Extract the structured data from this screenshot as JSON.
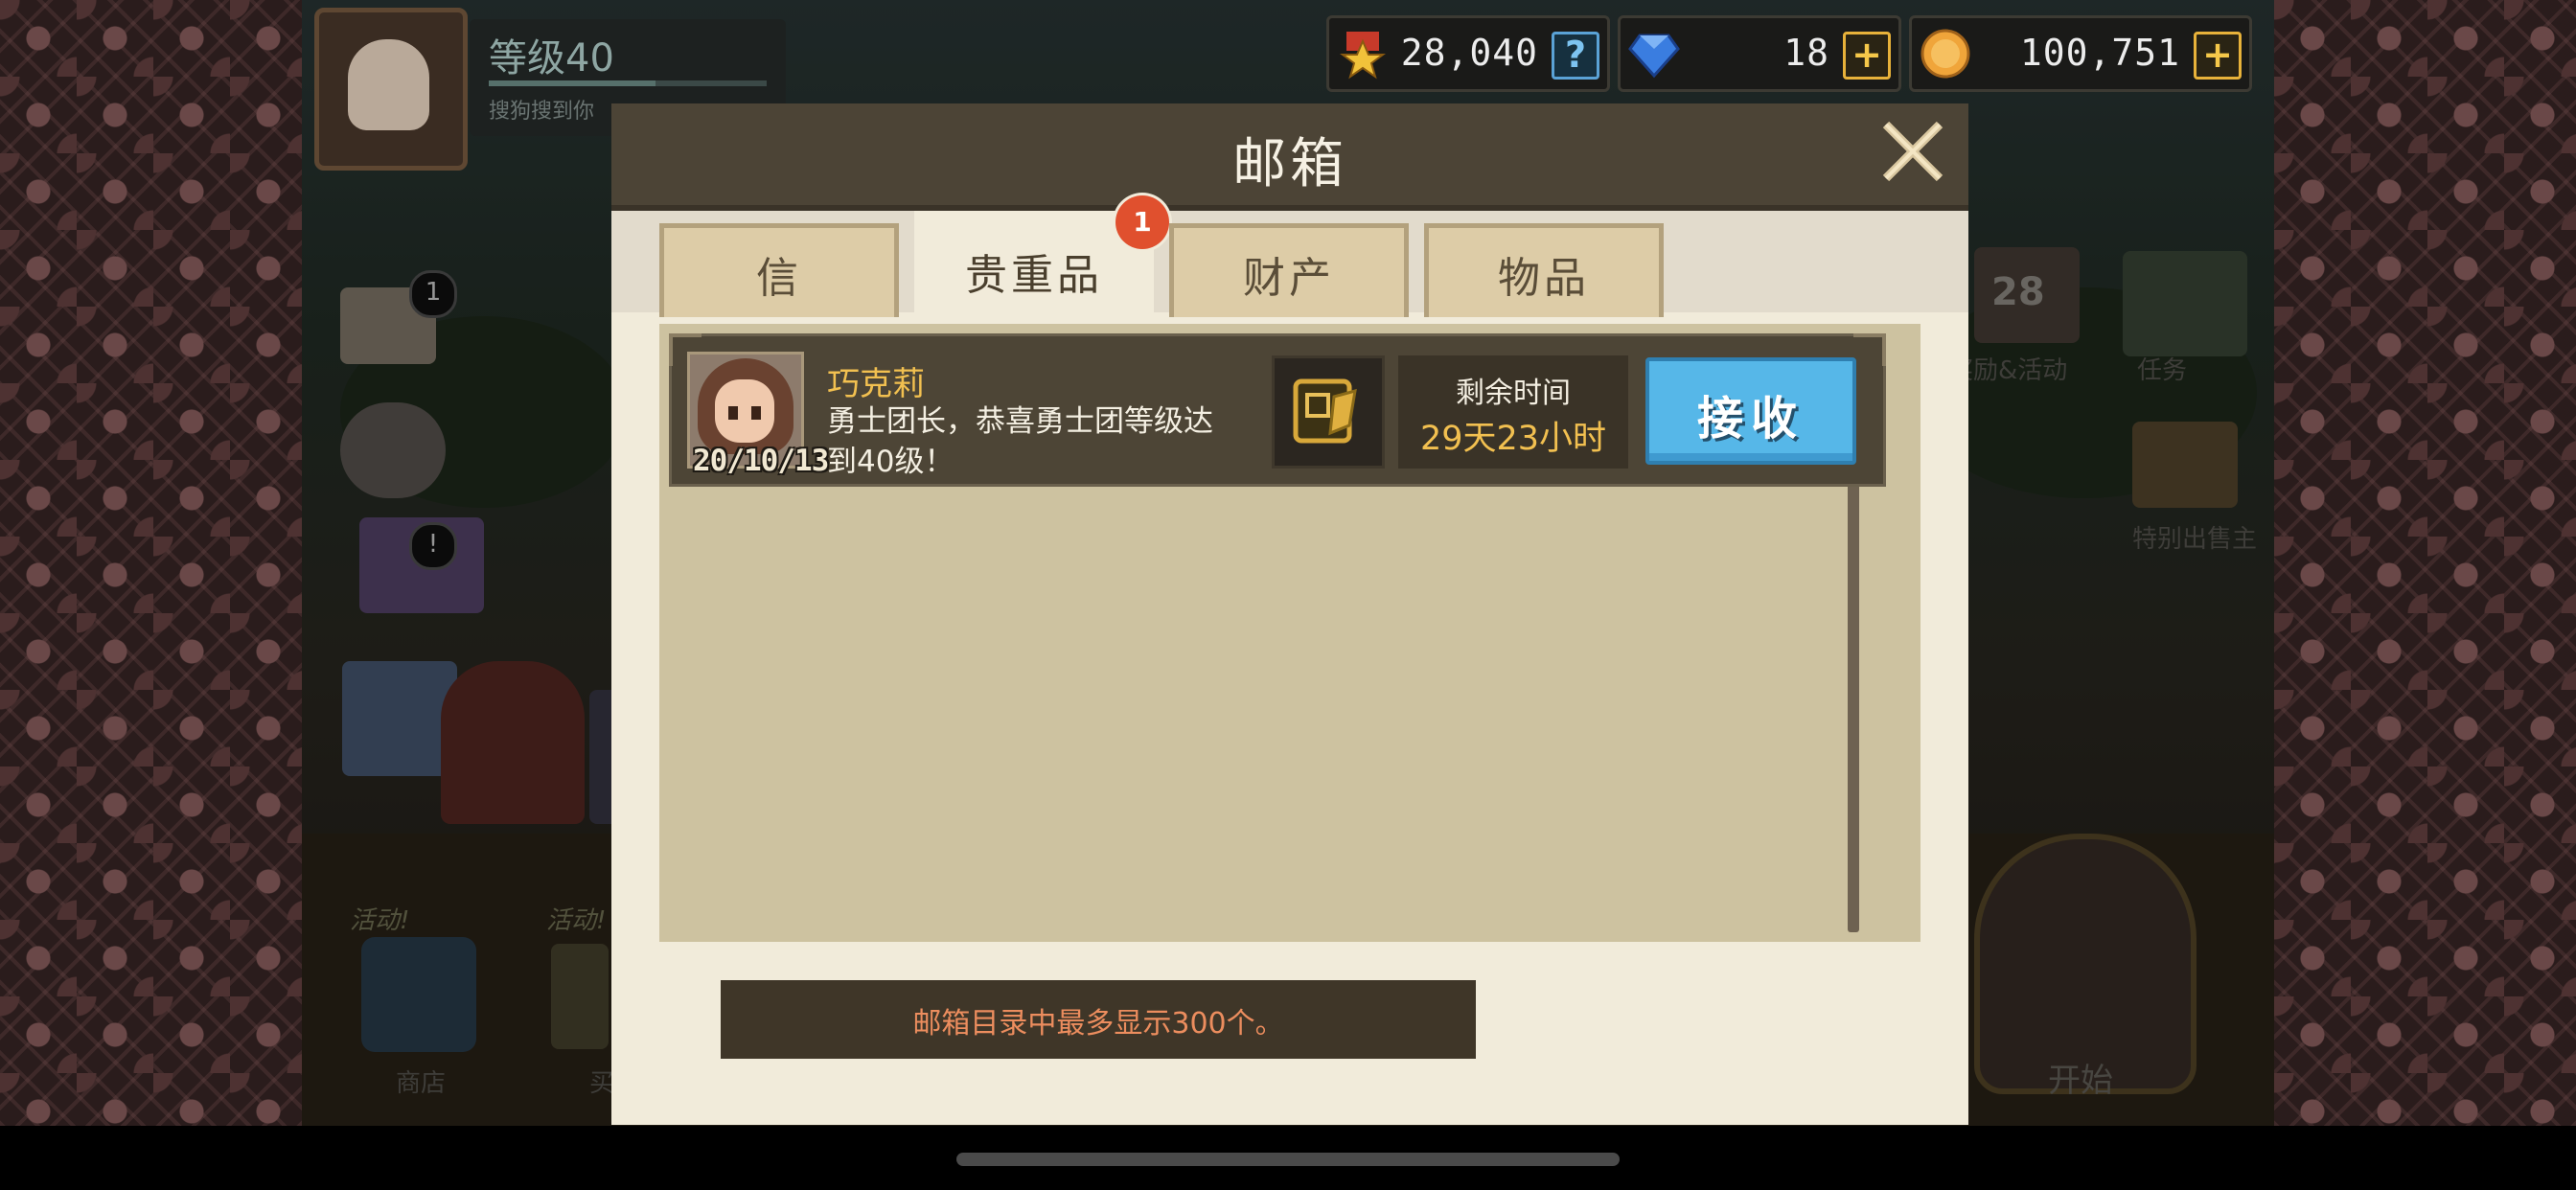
{
  "hud": {
    "level": "等级40",
    "level_sub": "搜狗搜到你",
    "medals": "28,040",
    "gems": "18",
    "coins": "100,751",
    "medal_icon": "medal-icon",
    "gem_icon": "gem-icon",
    "coin_icon": "coin-icon",
    "help_label": "?",
    "plus_label": "+"
  },
  "background": {
    "left_badges": [
      "1",
      "!"
    ],
    "bottom_labels": [
      "活动!",
      "活动!",
      "商店",
      "买"
    ],
    "right_labels": [
      "奖励&活动",
      "任务",
      "特别出售主",
      "开始"
    ],
    "calendar_day": "28"
  },
  "modal": {
    "title": "邮箱",
    "close_icon": "close-icon",
    "tabs": [
      {
        "label": "信"
      },
      {
        "label": "贵重品",
        "badge": "1"
      },
      {
        "label": "财产"
      },
      {
        "label": "物品"
      }
    ],
    "mails": [
      {
        "sender": "巧克莉",
        "date": "20/10/13",
        "message": "勇士团长，恭喜勇士团等级达到40级！",
        "attachment_icon": "gold-ticket-icon",
        "remaining_label": "剩余时间",
        "remaining_value": "29天23小时",
        "button": "接收"
      }
    ],
    "footer": "邮箱目录中最多显示300个。"
  },
  "colors": {
    "header": "#4c4436",
    "panel": "#f1ebda",
    "list": "#cdc2a0",
    "accent_gold": "#f2c050",
    "button_blue": "#56b7e8",
    "badge_red": "#e0502e",
    "footer_text": "#ec8d5e"
  }
}
